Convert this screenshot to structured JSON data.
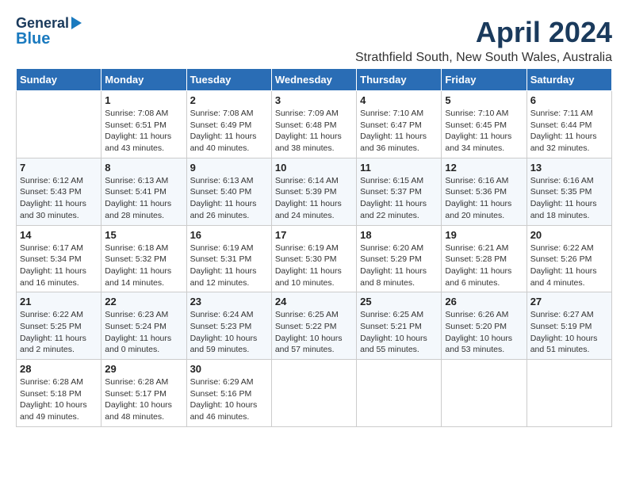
{
  "logo": {
    "line1": "General",
    "line2": "Blue"
  },
  "title": "April 2024",
  "subtitle": "Strathfield South, New South Wales, Australia",
  "headers": [
    "Sunday",
    "Monday",
    "Tuesday",
    "Wednesday",
    "Thursday",
    "Friday",
    "Saturday"
  ],
  "weeks": [
    [
      {
        "day": "",
        "sunrise": "",
        "sunset": "",
        "daylight": ""
      },
      {
        "day": "1",
        "sunrise": "Sunrise: 7:08 AM",
        "sunset": "Sunset: 6:51 PM",
        "daylight": "Daylight: 11 hours and 43 minutes."
      },
      {
        "day": "2",
        "sunrise": "Sunrise: 7:08 AM",
        "sunset": "Sunset: 6:49 PM",
        "daylight": "Daylight: 11 hours and 40 minutes."
      },
      {
        "day": "3",
        "sunrise": "Sunrise: 7:09 AM",
        "sunset": "Sunset: 6:48 PM",
        "daylight": "Daylight: 11 hours and 38 minutes."
      },
      {
        "day": "4",
        "sunrise": "Sunrise: 7:10 AM",
        "sunset": "Sunset: 6:47 PM",
        "daylight": "Daylight: 11 hours and 36 minutes."
      },
      {
        "day": "5",
        "sunrise": "Sunrise: 7:10 AM",
        "sunset": "Sunset: 6:45 PM",
        "daylight": "Daylight: 11 hours and 34 minutes."
      },
      {
        "day": "6",
        "sunrise": "Sunrise: 7:11 AM",
        "sunset": "Sunset: 6:44 PM",
        "daylight": "Daylight: 11 hours and 32 minutes."
      }
    ],
    [
      {
        "day": "7",
        "sunrise": "Sunrise: 6:12 AM",
        "sunset": "Sunset: 5:43 PM",
        "daylight": "Daylight: 11 hours and 30 minutes."
      },
      {
        "day": "8",
        "sunrise": "Sunrise: 6:13 AM",
        "sunset": "Sunset: 5:41 PM",
        "daylight": "Daylight: 11 hours and 28 minutes."
      },
      {
        "day": "9",
        "sunrise": "Sunrise: 6:13 AM",
        "sunset": "Sunset: 5:40 PM",
        "daylight": "Daylight: 11 hours and 26 minutes."
      },
      {
        "day": "10",
        "sunrise": "Sunrise: 6:14 AM",
        "sunset": "Sunset: 5:39 PM",
        "daylight": "Daylight: 11 hours and 24 minutes."
      },
      {
        "day": "11",
        "sunrise": "Sunrise: 6:15 AM",
        "sunset": "Sunset: 5:37 PM",
        "daylight": "Daylight: 11 hours and 22 minutes."
      },
      {
        "day": "12",
        "sunrise": "Sunrise: 6:16 AM",
        "sunset": "Sunset: 5:36 PM",
        "daylight": "Daylight: 11 hours and 20 minutes."
      },
      {
        "day": "13",
        "sunrise": "Sunrise: 6:16 AM",
        "sunset": "Sunset: 5:35 PM",
        "daylight": "Daylight: 11 hours and 18 minutes."
      }
    ],
    [
      {
        "day": "14",
        "sunrise": "Sunrise: 6:17 AM",
        "sunset": "Sunset: 5:34 PM",
        "daylight": "Daylight: 11 hours and 16 minutes."
      },
      {
        "day": "15",
        "sunrise": "Sunrise: 6:18 AM",
        "sunset": "Sunset: 5:32 PM",
        "daylight": "Daylight: 11 hours and 14 minutes."
      },
      {
        "day": "16",
        "sunrise": "Sunrise: 6:19 AM",
        "sunset": "Sunset: 5:31 PM",
        "daylight": "Daylight: 11 hours and 12 minutes."
      },
      {
        "day": "17",
        "sunrise": "Sunrise: 6:19 AM",
        "sunset": "Sunset: 5:30 PM",
        "daylight": "Daylight: 11 hours and 10 minutes."
      },
      {
        "day": "18",
        "sunrise": "Sunrise: 6:20 AM",
        "sunset": "Sunset: 5:29 PM",
        "daylight": "Daylight: 11 hours and 8 minutes."
      },
      {
        "day": "19",
        "sunrise": "Sunrise: 6:21 AM",
        "sunset": "Sunset: 5:28 PM",
        "daylight": "Daylight: 11 hours and 6 minutes."
      },
      {
        "day": "20",
        "sunrise": "Sunrise: 6:22 AM",
        "sunset": "Sunset: 5:26 PM",
        "daylight": "Daylight: 11 hours and 4 minutes."
      }
    ],
    [
      {
        "day": "21",
        "sunrise": "Sunrise: 6:22 AM",
        "sunset": "Sunset: 5:25 PM",
        "daylight": "Daylight: 11 hours and 2 minutes."
      },
      {
        "day": "22",
        "sunrise": "Sunrise: 6:23 AM",
        "sunset": "Sunset: 5:24 PM",
        "daylight": "Daylight: 11 hours and 0 minutes."
      },
      {
        "day": "23",
        "sunrise": "Sunrise: 6:24 AM",
        "sunset": "Sunset: 5:23 PM",
        "daylight": "Daylight: 10 hours and 59 minutes."
      },
      {
        "day": "24",
        "sunrise": "Sunrise: 6:25 AM",
        "sunset": "Sunset: 5:22 PM",
        "daylight": "Daylight: 10 hours and 57 minutes."
      },
      {
        "day": "25",
        "sunrise": "Sunrise: 6:25 AM",
        "sunset": "Sunset: 5:21 PM",
        "daylight": "Daylight: 10 hours and 55 minutes."
      },
      {
        "day": "26",
        "sunrise": "Sunrise: 6:26 AM",
        "sunset": "Sunset: 5:20 PM",
        "daylight": "Daylight: 10 hours and 53 minutes."
      },
      {
        "day": "27",
        "sunrise": "Sunrise: 6:27 AM",
        "sunset": "Sunset: 5:19 PM",
        "daylight": "Daylight: 10 hours and 51 minutes."
      }
    ],
    [
      {
        "day": "28",
        "sunrise": "Sunrise: 6:28 AM",
        "sunset": "Sunset: 5:18 PM",
        "daylight": "Daylight: 10 hours and 49 minutes."
      },
      {
        "day": "29",
        "sunrise": "Sunrise: 6:28 AM",
        "sunset": "Sunset: 5:17 PM",
        "daylight": "Daylight: 10 hours and 48 minutes."
      },
      {
        "day": "30",
        "sunrise": "Sunrise: 6:29 AM",
        "sunset": "Sunset: 5:16 PM",
        "daylight": "Daylight: 10 hours and 46 minutes."
      },
      {
        "day": "",
        "sunrise": "",
        "sunset": "",
        "daylight": ""
      },
      {
        "day": "",
        "sunrise": "",
        "sunset": "",
        "daylight": ""
      },
      {
        "day": "",
        "sunrise": "",
        "sunset": "",
        "daylight": ""
      },
      {
        "day": "",
        "sunrise": "",
        "sunset": "",
        "daylight": ""
      }
    ]
  ]
}
